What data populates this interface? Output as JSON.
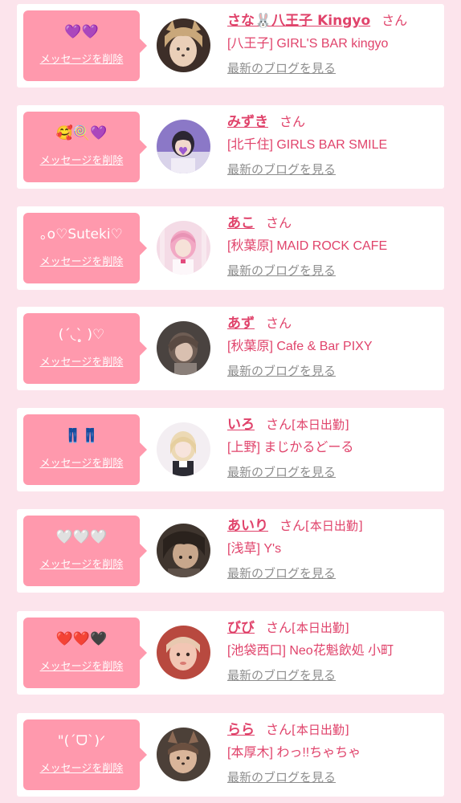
{
  "colors": {
    "background": "#fce4ec",
    "card": "#ffffff",
    "bubble": "#ff99ad",
    "accent": "#e0436b",
    "muted": "#8e8e8e"
  },
  "delete_label": "メッセージを削除",
  "blog_label": "最新のブログを見る",
  "san_label": "さん",
  "today_label": "[本日出勤]",
  "entries": [
    {
      "message": "💜💜",
      "name": "さな🐰八王子 Kingyo",
      "shop": "[八王子] GIRL'S BAR kingyo",
      "today": "",
      "avatar_icon": "cat-filter-portrait"
    },
    {
      "message": "🥰🍭💜",
      "name": "みずき",
      "shop": "[北千住] GIRLS BAR SMILE",
      "today": "",
      "avatar_icon": "girl-portrait"
    },
    {
      "message": "｡o♡Suteki♡",
      "name": "あこ",
      "shop": "[秋葉原] MAID ROCK CAFE",
      "today": "",
      "avatar_icon": "pink-hair-girl-portrait"
    },
    {
      "message": "(ˊ◟ˋ̥̥̥̥̥ )♡",
      "name": "あず",
      "shop": "[秋葉原] Cafe & Bar PIXY",
      "today": "",
      "avatar_icon": "girl-portrait"
    },
    {
      "message": "👖👖",
      "name": "いろ",
      "shop": "[上野] まじかるどーる",
      "today": "[本日出勤]",
      "avatar_icon": "blonde-girl-portrait"
    },
    {
      "message": "🤍🤍🤍",
      "name": "あいり",
      "shop": "[浅草] Y's",
      "today": "[本日出勤]",
      "avatar_icon": "girl-portrait"
    },
    {
      "message": "❤️❤️🖤",
      "name": "びび",
      "shop": "[池袋西口] Neo花魁飲処 小町",
      "today": "[本日出勤]",
      "avatar_icon": "girl-portrait"
    },
    {
      "message": "\"(ˊᗜˋ)ᐟ",
      "name": "らら",
      "shop": "[本厚木] わっ!!ちゃちゃ",
      "today": "[本日出勤]",
      "avatar_icon": "cat-filter-portrait"
    }
  ]
}
